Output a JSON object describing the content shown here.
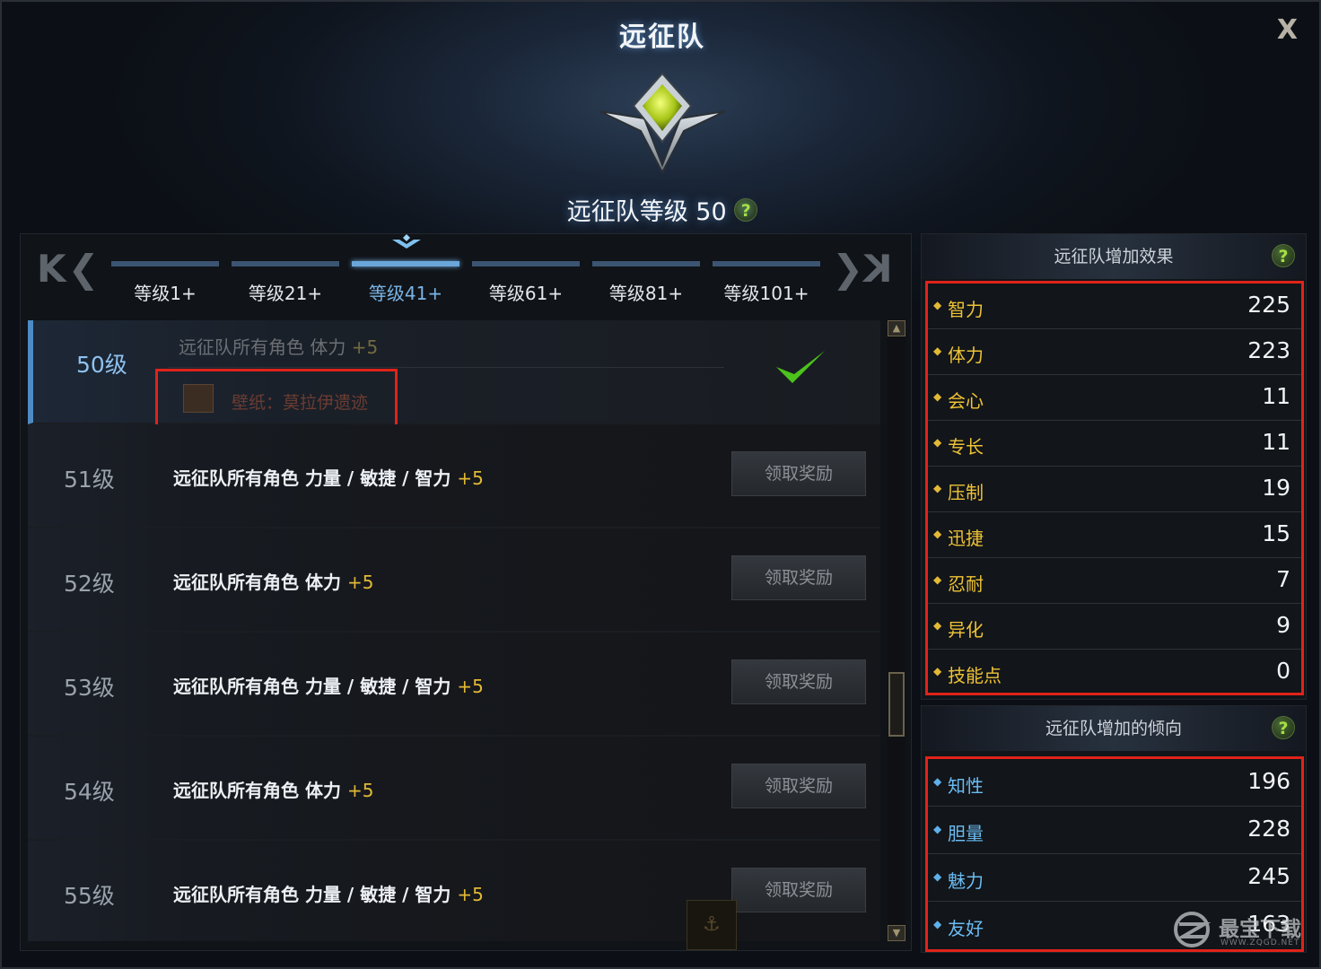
{
  "window": {
    "title": "远征队",
    "close_label": "X"
  },
  "expedition": {
    "level_label": "远征队等级 50",
    "help": "?"
  },
  "nav": {
    "first": "K",
    "prev": "❮",
    "next": "❯",
    "last": "K"
  },
  "tabs": [
    {
      "label": "等级1+"
    },
    {
      "label": "等级21+"
    },
    {
      "label": "等级41+"
    },
    {
      "label": "等级61+"
    },
    {
      "label": "等级81+"
    },
    {
      "label": "等级101+"
    }
  ],
  "active_tab": 2,
  "rewards": [
    {
      "level": "50级",
      "text": "远征队所有角色 体力",
      "bonus": "+5",
      "item": "壁纸：莫拉伊遗迹",
      "claimed": true
    },
    {
      "level": "51级",
      "text": "远征队所有角色 力量 / 敏捷 / 智力",
      "bonus": "+5",
      "button": "领取奖励"
    },
    {
      "level": "52级",
      "text": "远征队所有角色 体力",
      "bonus": "+5",
      "button": "领取奖励"
    },
    {
      "level": "53级",
      "text": "远征队所有角色 力量 / 敏捷 / 智力",
      "bonus": "+5",
      "button": "领取奖励"
    },
    {
      "level": "54级",
      "text": "远征队所有角色 体力",
      "bonus": "+5",
      "button": "领取奖励"
    },
    {
      "level": "55级",
      "text": "远征队所有角色 力量 / 敏捷 / 智力",
      "bonus": "+5",
      "button": "领取奖励"
    }
  ],
  "effects": {
    "title": "远征队增加效果",
    "help": "?",
    "stats": [
      {
        "name": "智力",
        "value": "225"
      },
      {
        "name": "体力",
        "value": "223"
      },
      {
        "name": "会心",
        "value": "11"
      },
      {
        "name": "专长",
        "value": "11"
      },
      {
        "name": "压制",
        "value": "19"
      },
      {
        "name": "迅捷",
        "value": "15"
      },
      {
        "name": "忍耐",
        "value": "7"
      },
      {
        "name": "异化",
        "value": "9"
      },
      {
        "name": "技能点",
        "value": "0"
      }
    ]
  },
  "tendencies": {
    "title": "远征队增加的倾向",
    "help": "?",
    "stats": [
      {
        "name": "知性",
        "value": "196"
      },
      {
        "name": "胆量",
        "value": "228"
      },
      {
        "name": "魅力",
        "value": "245"
      },
      {
        "name": "友好",
        "value": "163"
      }
    ]
  },
  "watermark": {
    "text": "最宝下载",
    "sub": "WWW.ZQGD.NET"
  },
  "colors": {
    "accent_blue": "#6aa6d9",
    "gold": "#e3b935",
    "highlight_red": "#e0231a",
    "check_green": "#4cc21c"
  }
}
